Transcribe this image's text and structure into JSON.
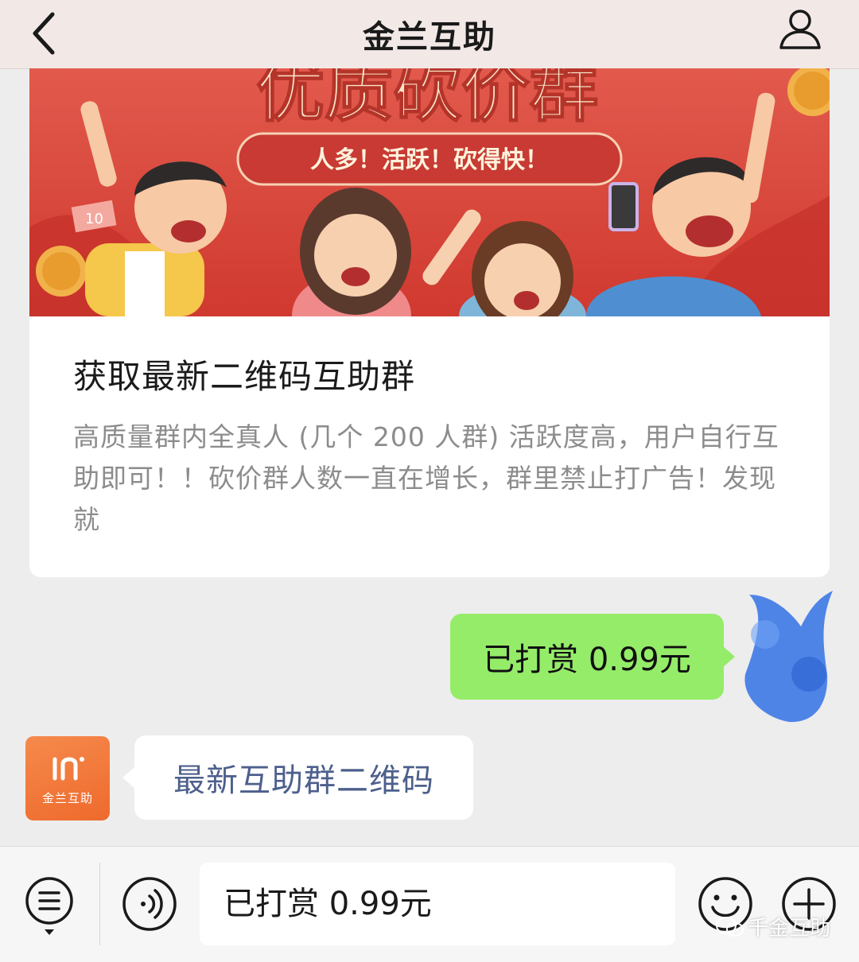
{
  "header": {
    "title": "金兰互助",
    "back_icon": "chevron-left-icon",
    "profile_icon": "person-icon"
  },
  "article": {
    "banner": {
      "headline": "优质砍价群",
      "slogan": "人多！活跃！砍得快！",
      "bill_value": "10"
    },
    "title": "获取最新二维码互助群",
    "description": "高质量群内全真人 (几个 200 人群) 活跃度高，用户自行互助即可！！砍价群人数一直在增长，群里禁止打广告！发现就"
  },
  "messages": {
    "sent": {
      "text": "已打赏 0.99元"
    },
    "received": {
      "text": "最新互助群二维码",
      "avatar_name": "金兰互助"
    }
  },
  "bottom_bar": {
    "input_value": "已打赏 0.99元",
    "watermark": "千金互助"
  },
  "colors": {
    "sent_bubble": "#95ec69",
    "header_bg": "#f2e9e7",
    "banner_red": "#d9423f",
    "avatar_orange": "#f27a3c"
  }
}
